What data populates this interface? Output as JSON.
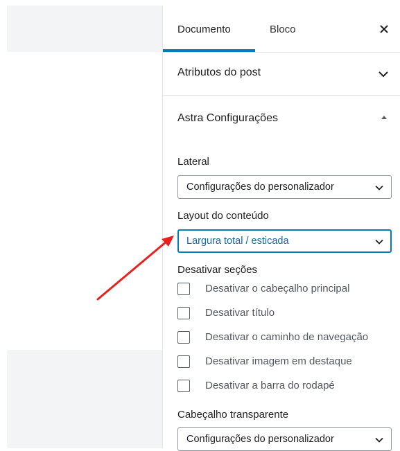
{
  "tabs": [
    {
      "label": "Documento",
      "active": true
    },
    {
      "label": "Bloco",
      "active": false
    }
  ],
  "close_icon": "close-icon",
  "panels": {
    "post_attributes": {
      "title": "Atributos do post",
      "expanded": false
    },
    "astra": {
      "title": "Astra Configurações",
      "expanded": true
    }
  },
  "fields": {
    "sidebar": {
      "label": "Lateral",
      "value": "Configurações do personalizador"
    },
    "content_layout": {
      "label": "Layout do conteúdo",
      "value": "Largura total / esticada"
    },
    "disable_sections": {
      "label": "Desativar seções",
      "options": [
        {
          "label": "Desativar o cabeçalho principal",
          "checked": false
        },
        {
          "label": "Desativar título",
          "checked": false
        },
        {
          "label": "Desativar o caminho de navegação",
          "checked": false
        },
        {
          "label": "Desativar imagem em destaque",
          "checked": false
        },
        {
          "label": "Desativar a barra do rodapé",
          "checked": false
        }
      ]
    },
    "transparent_header": {
      "label": "Cabeçalho transparente",
      "value": "Configurações do personalizador"
    }
  },
  "colors": {
    "accent": "#007cba",
    "annotation_arrow": "#e8211e"
  }
}
